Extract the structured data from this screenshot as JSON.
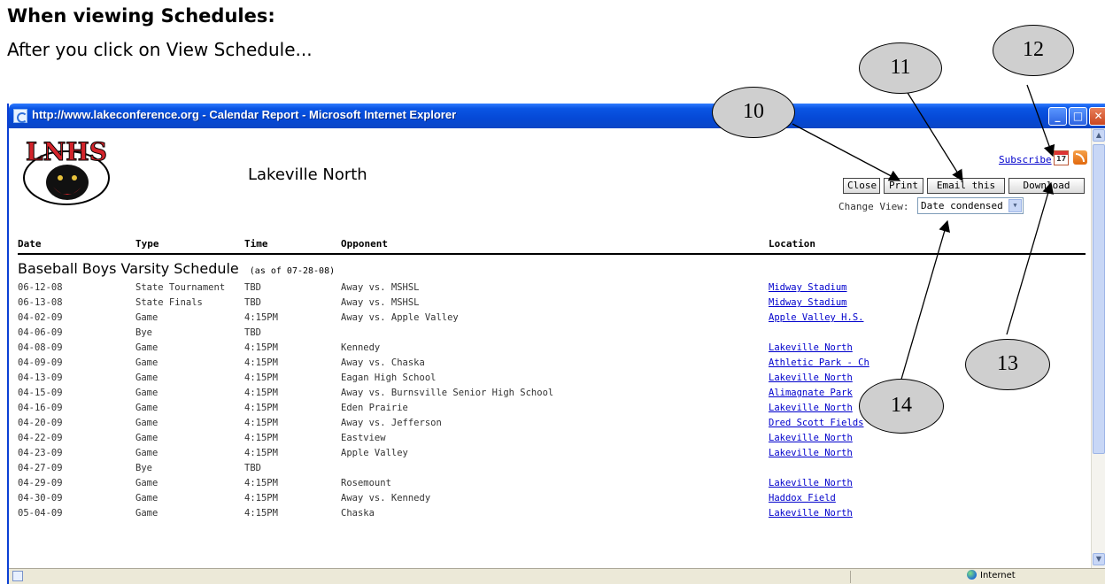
{
  "document": {
    "heading": "When viewing Schedules:",
    "intro": "After you click on View Schedule..."
  },
  "window": {
    "title": "http://www.lakeconference.org - Calendar Report - Microsoft Internet Explorer",
    "minimize": "_",
    "maximize": "□",
    "close": "✕"
  },
  "page": {
    "team_name": "Lakeville North",
    "logo_text": "LNHS",
    "subscribe": "Subscribe",
    "calendar_icon_label": "17",
    "buttons": {
      "close": "Close",
      "print": "Print",
      "email": "Email this",
      "download": "Download"
    },
    "change_view_label": "Change View:",
    "change_view_value": "Date condensed",
    "columns": [
      "Date",
      "Type",
      "Time",
      "Opponent",
      "Location"
    ],
    "schedule_title": "Baseball Boys Varsity Schedule",
    "as_of": "(as of 07-28-08)",
    "rows": [
      {
        "date": "06-12-08",
        "type": "State Tournament",
        "time": "TBD",
        "opponent": "Away vs. MSHSL",
        "location": "Midway Stadium"
      },
      {
        "date": "06-13-08",
        "type": "State Finals",
        "time": "TBD",
        "opponent": "Away vs. MSHSL",
        "location": "Midway Stadium"
      },
      {
        "date": "04-02-09",
        "type": "Game",
        "time": "4:15PM",
        "opponent": "Away vs. Apple Valley",
        "location": "Apple Valley H.S."
      },
      {
        "date": "04-06-09",
        "type": "Bye",
        "time": "TBD",
        "opponent": "",
        "location": ""
      },
      {
        "date": "04-08-09",
        "type": "Game",
        "time": "4:15PM",
        "opponent": "Kennedy",
        "location": "Lakeville North"
      },
      {
        "date": "04-09-09",
        "type": "Game",
        "time": "4:15PM",
        "opponent": "Away vs. Chaska",
        "location": "Athletic Park - Ch"
      },
      {
        "date": "04-13-09",
        "type": "Game",
        "time": "4:15PM",
        "opponent": "Eagan High School",
        "location": "Lakeville North"
      },
      {
        "date": "04-15-09",
        "type": "Game",
        "time": "4:15PM",
        "opponent": "Away vs. Burnsville Senior High School",
        "location": "Alimagnate Park"
      },
      {
        "date": "04-16-09",
        "type": "Game",
        "time": "4:15PM",
        "opponent": "Eden Prairie",
        "location": "Lakeville North"
      },
      {
        "date": "04-20-09",
        "type": "Game",
        "time": "4:15PM",
        "opponent": "Away vs. Jefferson",
        "location": "Dred Scott Fields"
      },
      {
        "date": "04-22-09",
        "type": "Game",
        "time": "4:15PM",
        "opponent": "Eastview",
        "location": "Lakeville North"
      },
      {
        "date": "04-23-09",
        "type": "Game",
        "time": "4:15PM",
        "opponent": "Apple Valley",
        "location": "Lakeville North"
      },
      {
        "date": "04-27-09",
        "type": "Bye",
        "time": "TBD",
        "opponent": "",
        "location": ""
      },
      {
        "date": "04-29-09",
        "type": "Game",
        "time": "4:15PM",
        "opponent": "Rosemount",
        "location": "Lakeville North"
      },
      {
        "date": "04-30-09",
        "type": "Game",
        "time": "4:15PM",
        "opponent": "Away vs. Kennedy",
        "location": "Haddox Field"
      },
      {
        "date": "05-04-09",
        "type": "Game",
        "time": "4:15PM",
        "opponent": "Chaska",
        "location": "Lakeville North"
      }
    ]
  },
  "status_bar": {
    "zone": "Internet"
  },
  "callouts": [
    "10",
    "11",
    "12",
    "13",
    "14"
  ],
  "colors": {
    "title_bar": "#0549d6",
    "link": "#0000cc",
    "callout_fill": "#cfcfcf",
    "logo_red": "#d4242b"
  }
}
